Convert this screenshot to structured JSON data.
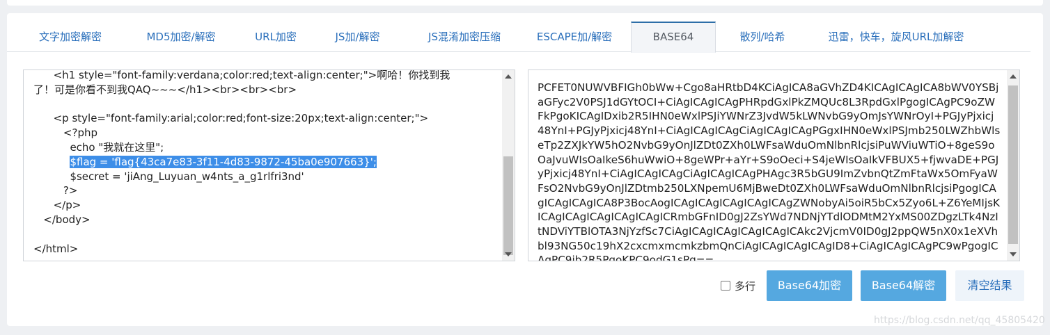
{
  "tabs": [
    {
      "label": "文字加密解密"
    },
    {
      "label": "MD5加密/解密"
    },
    {
      "label": "URL加密"
    },
    {
      "label": "JS加/解密"
    },
    {
      "label": "JS混淆加密压缩"
    },
    {
      "label": "ESCAPE加/解密"
    },
    {
      "label": "BASE64",
      "active": true
    },
    {
      "label": "散列/哈希"
    },
    {
      "label": "迅雷，快车，旋风URL加解密"
    }
  ],
  "input": {
    "lines": [
      "      <h1 style=\"font-family:verdana;color:red;text-align:center;\">啊哈！你找到我",
      "了！可是你看不到我QAQ~~~</h1><br><br><br>",
      "",
      "      <p style=\"font-family:arial;color:red;font-size:20px;text-align:center;\">",
      "         <?php",
      "           echo \"我就在这里\";",
      "           $flag = 'flag{43ca7e83-3f11-4d83-9872-45ba0e907663}';",
      "           $secret = 'jiAng_Luyuan_w4nts_a_g1rlfri3nd'",
      "         ?>",
      "      </p>",
      "   </body>",
      "",
      "</html>"
    ]
  },
  "output": {
    "text": "PCFET0NUWVBFIGh0bWw+Cgo8aHRtbD4KCiAgICA8aGVhZD4KICAgICAgICA8bWV0YSBjaGFyc2V0PSJ1dGYtOCI+CiAgICAgICAgPHRpdGxlPkZMQUc8L3RpdGxlPgogICAgPC9oZWFkPgoKICAgIDxib2R5IHN0eWxlPSJiYWNrZ3JvdW5kLWNvbG9yOmJsYWNrOyI+PGJyPjxicj48YnI+PGJyPjxicj48YnI+CiAgICAgICAgCiAgICAgICAgPGgxIHN0eWxlPSJmb250LWZhbWlseTp2ZXJkYW5hO2NvbG9yOnJlZDt0ZXh0LWFsaWduOmNlbnRlcjsiPuWViuWTiO+8geS9oOaJvuWIsOaIkeS6huWwiO+8geWPr+aYr+S9oOeci+S4jeWIsOaIkVFBUX5+fjwvaDE+PGJyPjxicj48YnI+CiAgICAgICAgCiAgICAgICAgPHAgc3R5bGU9ImZvbnQtZmFtaWx5OmFyaWFsO2NvbG9yOnJlZDtmb250LXNpemU6MjBweDt0ZXh0LWFsaWduOmNlbnRlcjsiPgogICAgICAgICAgICA8P3BocAogICAgICAgICAgICAgICAgZWNobyAi5oiR5bCx5Zyo6L+Z6YeMIjsKICAgICAgICAgICAgICAgICRmbGFnID0gJ2ZsYWd7NDNjYTdlODMtM2YxMS00ZDgzLTk4NzItNDViYTBlOTA3NjYzfSc7CiAgICAgICAgICAgICAgICAkc2VjcmV0ID0gJ2ppQW5nX0x1eXVhbl93NG50c19hX2cxcmxmcmkzbmQnCiAgICAgICAgICAgID8+CiAgICAgICAgPC9wPgogICAgPC9ib2R5PgoKPC9odG1sPg=="
  },
  "controls": {
    "multiline_label": "多行",
    "multiline_checked": false,
    "encode_button": "Base64加密",
    "decode_button": "Base64解密",
    "clear_button": "清空结果"
  },
  "watermark": "https://blog.csdn.net/qq_45805420",
  "colors": {
    "accent": "#55a8e0",
    "tab_text": "#2a6fbb",
    "selection": "#3d8ee8"
  }
}
